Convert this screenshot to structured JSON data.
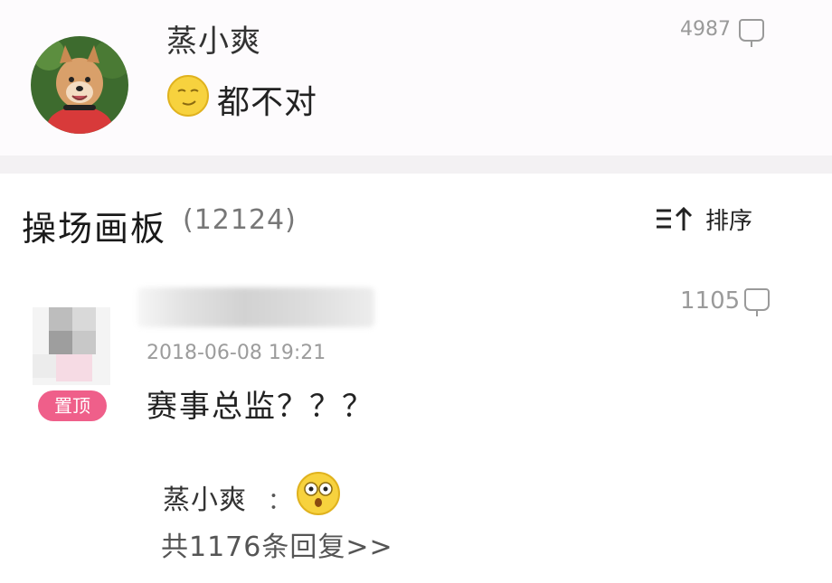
{
  "top_comment": {
    "username": "蒸小爽",
    "text": "都不对",
    "like_count": "4987",
    "avatar_icon": "shiba-dog-avatar",
    "emoji_icon": "smirk-face-emoji"
  },
  "board": {
    "title": "操场画板",
    "count": "(12124)",
    "sort_label": "排序",
    "sort_icon": "sort-bars-arrow-up-icon"
  },
  "post": {
    "pin_label": "置顶",
    "date": "2018-06-08 19:21",
    "text": "赛事总监？？？",
    "like_count": "1105",
    "like_icon": "thumb-like-icon",
    "reply": {
      "username": "蒸小爽",
      "colon": "：",
      "emoji_icon": "shocked-face-emoji",
      "reply_count_label": "共1176条回复>>"
    }
  },
  "colors": {
    "accent_pink": "#ef5f8a",
    "muted_text": "#9a9a9a",
    "card_bg": "#fdfbfd",
    "divider_bg": "#f3f1f3"
  }
}
